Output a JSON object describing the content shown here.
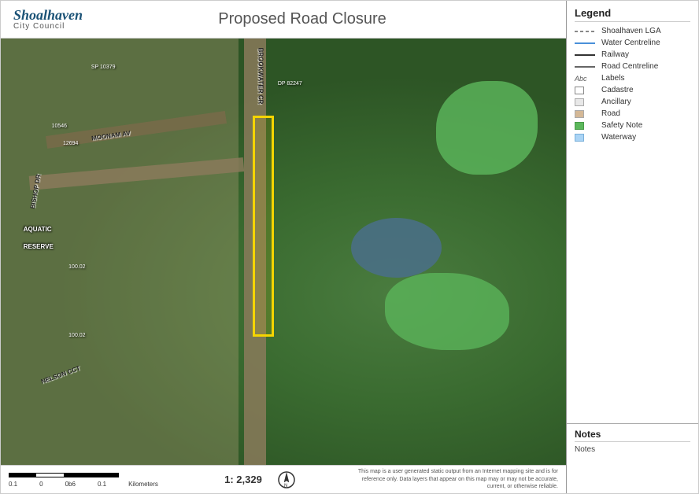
{
  "header": {
    "logo_main": "Shoalhaven",
    "logo_sub": "City Council",
    "title": "Proposed Road Closure"
  },
  "footer": {
    "scale_labels": [
      "0.1",
      "0",
      "0b6",
      "0.1",
      "Kilometers"
    ],
    "map_ratio": "1: 2,329",
    "disclaimer": "This map is a user generated static output from an Internet mapping site and is for reference only. Data layers that appear on this map may or may not be accurate, current, or otherwise reliable."
  },
  "legend": {
    "title": "Legend",
    "items": [
      {
        "id": "shoalhaven-lga",
        "symbol": "dashed",
        "label": "Shoalhaven LGA"
      },
      {
        "id": "water-centreline",
        "symbol": "solid-blue",
        "label": "Water Centreline"
      },
      {
        "id": "railway",
        "symbol": "solid-black",
        "label": "Railway"
      },
      {
        "id": "road-centreline",
        "symbol": "solid-dark",
        "label": "Road Centreline"
      },
      {
        "id": "labels",
        "symbol": "text",
        "label": "Labels"
      },
      {
        "id": "cadastre",
        "symbol": "box-outline",
        "label": "Cadastre"
      },
      {
        "id": "ancillary",
        "symbol": "box-light",
        "label": "Ancillary"
      },
      {
        "id": "road",
        "symbol": "box-peach",
        "label": "Road"
      },
      {
        "id": "safety-note",
        "symbol": "box-green",
        "label": "Safety Note"
      },
      {
        "id": "waterway",
        "symbol": "box-water",
        "label": "Waterway"
      }
    ]
  },
  "notes": {
    "title": "Notes",
    "content": "Notes"
  },
  "map": {
    "road_labels": [
      {
        "text": "MOONAM AV",
        "x": "15%",
        "y": "28%",
        "rotate": "-8deg"
      },
      {
        "text": "BROOKWATER CR",
        "x": "40%",
        "y": "10%",
        "rotate": "90deg"
      },
      {
        "text": "BISHOP DR",
        "x": "6%",
        "y": "38%",
        "rotate": "-80deg"
      }
    ],
    "parcel_labels": [
      {
        "text": "SP 10379",
        "x": "16%",
        "y": "8%"
      },
      {
        "text": "10546",
        "x": "10%",
        "y": "22%"
      },
      {
        "text": "12694",
        "x": "13%",
        "y": "25%"
      },
      {
        "text": "100.02",
        "x": "15%",
        "y": "56%"
      },
      {
        "text": "100.02",
        "x": "15%",
        "y": "73%"
      },
      {
        "text": "DP 82247",
        "x": "50%",
        "y": "12%"
      }
    ],
    "area_labels": [
      {
        "text": "AQUATIC",
        "x": "5%",
        "y": "47%"
      },
      {
        "text": "RESERVE",
        "x": "5%",
        "y": "50%"
      },
      {
        "text": "NELSON CCT",
        "x": "7%",
        "y": "82%"
      }
    ]
  }
}
